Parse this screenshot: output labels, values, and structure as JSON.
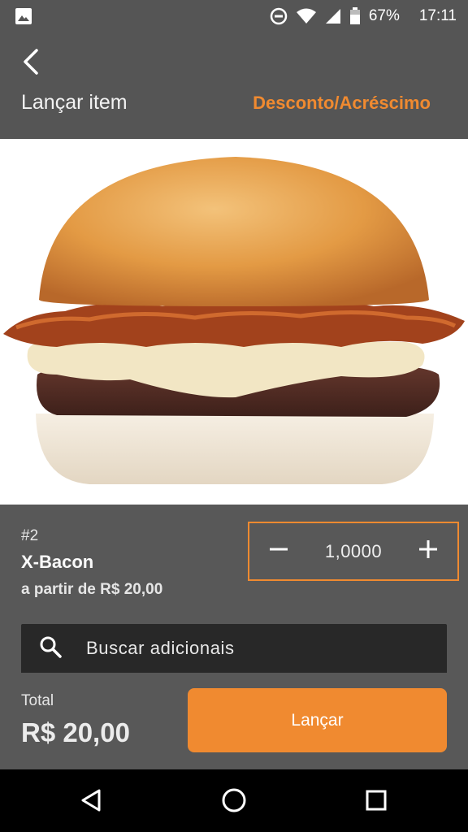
{
  "status_bar": {
    "battery": "67%",
    "time": "17:11",
    "icons": [
      "gallery-icon",
      "do-not-disturb-icon",
      "wifi-icon",
      "signal-icon",
      "battery-icon"
    ]
  },
  "app_bar": {
    "title": "Lançar item",
    "discount_link": "Desconto/Acréscimo",
    "back_icon": "chevron-left-icon"
  },
  "product": {
    "image": "x-bacon-burger-photo",
    "code": "#2",
    "name": "X-Bacon",
    "price_from": "a partir de R$ 20,00"
  },
  "stepper": {
    "quantity": "1,0000",
    "minus_icon": "minus-icon",
    "plus_icon": "plus-icon"
  },
  "search": {
    "placeholder": "Buscar adicionais",
    "icon": "search-icon"
  },
  "footer": {
    "total_label": "Total",
    "total_value": "R$ 20,00",
    "launch_button": "Lançar"
  },
  "nav_bar": {
    "icons": [
      "back-triangle-icon",
      "home-circle-icon",
      "recents-square-icon"
    ]
  },
  "colors": {
    "accent": "#f08a30",
    "bar_background": "#555555",
    "panel_background": "#585858",
    "search_background": "#282828"
  }
}
